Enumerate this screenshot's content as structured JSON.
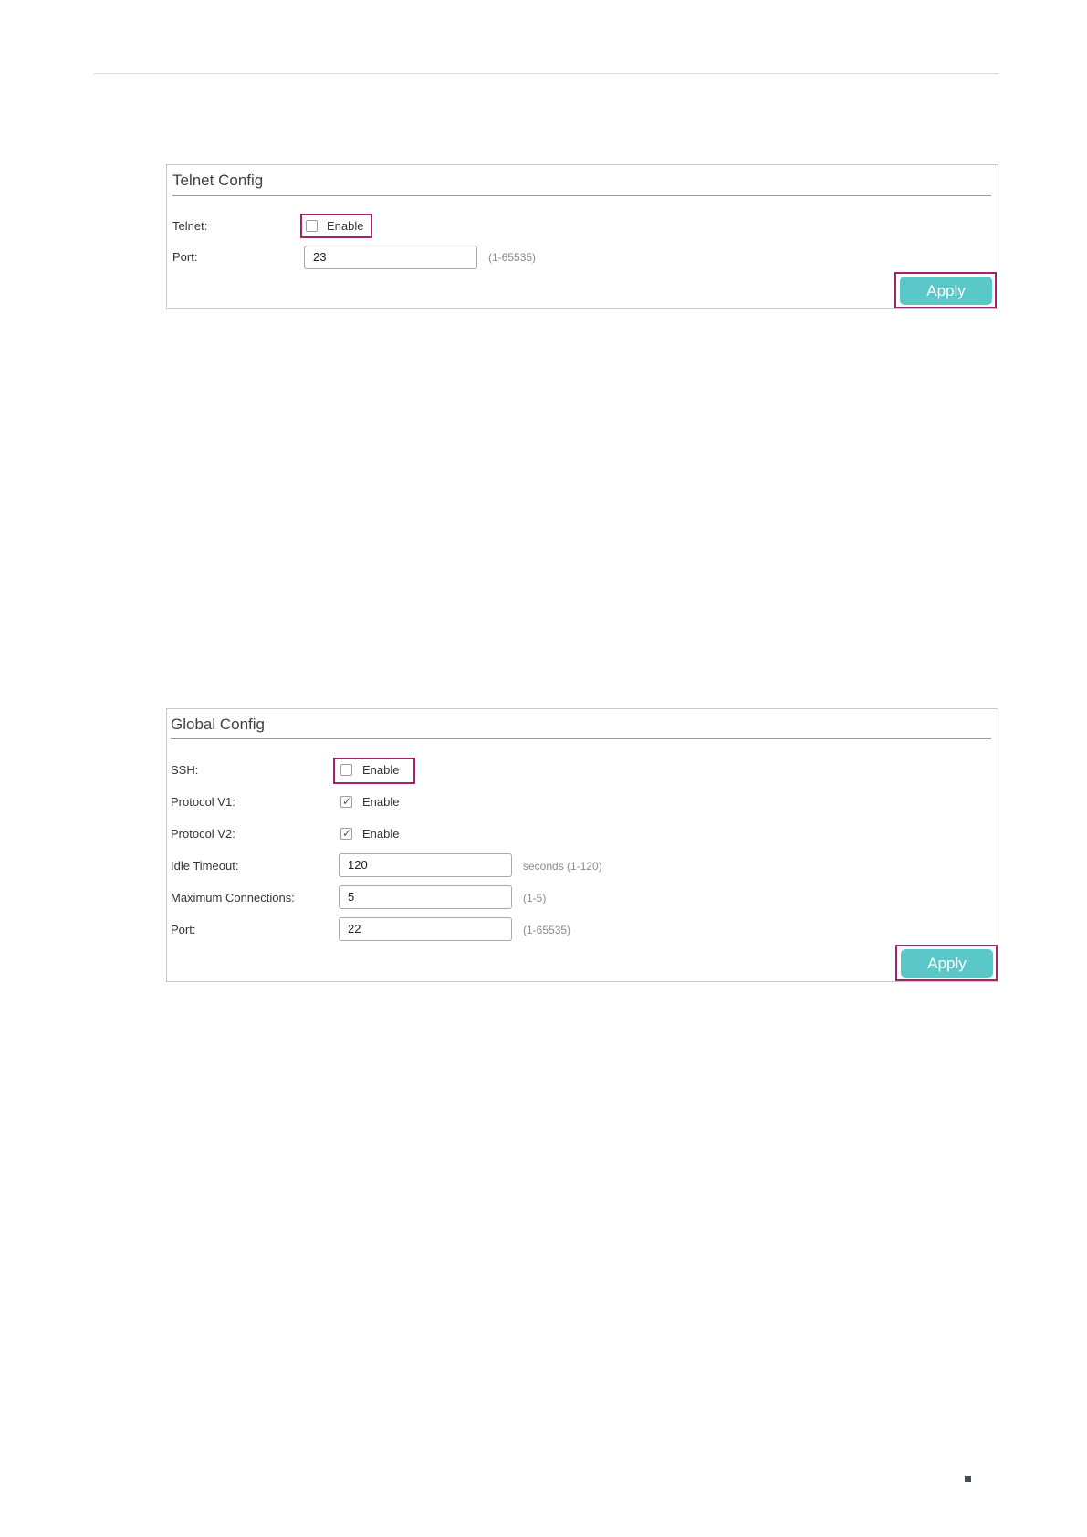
{
  "telnet_panel": {
    "title": "Telnet Config",
    "telnet_label": "Telnet:",
    "telnet_enable_text": "Enable",
    "telnet_enabled": false,
    "port_label": "Port:",
    "port_value": "23",
    "port_hint": "(1-65535)",
    "apply_label": "Apply"
  },
  "global_panel": {
    "title": "Global Config",
    "ssh_label": "SSH:",
    "ssh_enable_text": "Enable",
    "ssh_enabled": false,
    "v1_label": "Protocol V1:",
    "v1_enable_text": "Enable",
    "v1_enabled": true,
    "v2_label": "Protocol V2:",
    "v2_enable_text": "Enable",
    "v2_enabled": true,
    "idle_label": "Idle Timeout:",
    "idle_value": "120",
    "idle_hint": "seconds (1-120)",
    "max_label": "Maximum Connections:",
    "max_value": "5",
    "max_hint": "(1-5)",
    "port_label": "Port:",
    "port_value": "22",
    "port_hint": "(1-65535)",
    "apply_label": "Apply"
  },
  "colors": {
    "highlight": "#a0256b",
    "button": "#5ac8c8"
  }
}
